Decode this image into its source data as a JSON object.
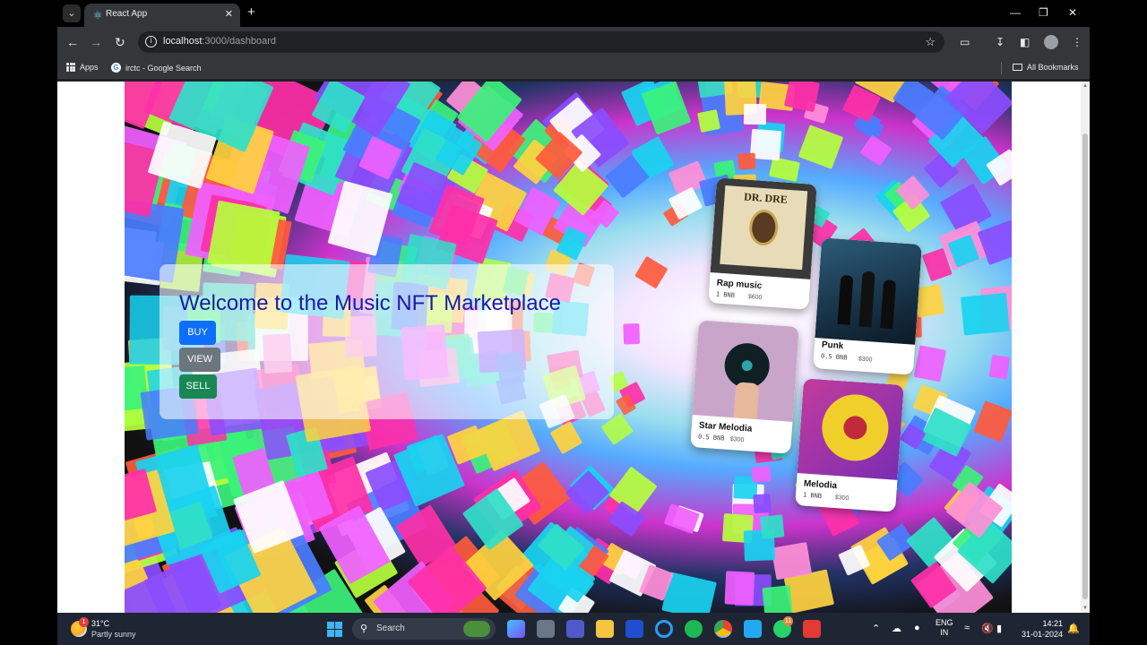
{
  "browser": {
    "tab_title": "React App",
    "url_host": "localhost",
    "url_path": ":3000/dashboard",
    "bookmarks": [
      {
        "label": "Apps",
        "icon": "apps-grid-icon"
      },
      {
        "label": "irctc - Google Search",
        "icon": "google-icon"
      }
    ],
    "all_bookmarks_label": "All Bookmarks"
  },
  "hero": {
    "title": "Welcome to the Music NFT Marketplace",
    "buttons": {
      "buy": "BUY",
      "view": "VIEW",
      "sell": "SELL"
    },
    "colors": {
      "buy": "#0d6efd",
      "view": "#6c757d",
      "sell": "#198754",
      "title": "#1a1aa8"
    }
  },
  "cards": [
    {
      "name": "Rap music",
      "amount": "1 BNB",
      "price": "$600"
    },
    {
      "name": "Punk",
      "amount": "0.5 BNB",
      "price": "$300"
    },
    {
      "name": "Star Melodia",
      "amount": "0.5 BNB",
      "price": "$300"
    },
    {
      "name": "Melodia",
      "amount": "1 BNB",
      "price": "$300"
    }
  ],
  "album_art_text": "DR. DRE",
  "taskbar": {
    "weather_temp": "31°C",
    "weather_desc": "Partly sunny",
    "weather_badge": "1",
    "search_label": "Search",
    "whatsapp_badge": "11",
    "lang_line1": "ENG",
    "lang_line2": "IN",
    "time": "14:21",
    "date": "31-01-2024"
  }
}
